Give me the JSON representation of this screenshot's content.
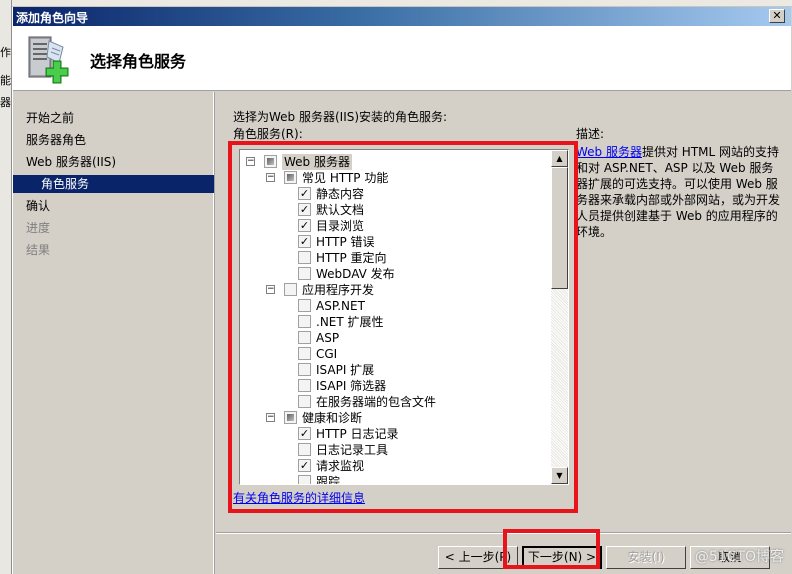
{
  "window": {
    "title": "添加角色向导",
    "close_icon": "close-icon"
  },
  "header": {
    "heading": "选择角色服务",
    "icon": "server-add-icon"
  },
  "background_app": {
    "fragments": [
      "作",
      "能",
      "器"
    ]
  },
  "nav": {
    "items": [
      {
        "label": "开始之前",
        "state": "normal"
      },
      {
        "label": "服务器角色",
        "state": "normal"
      },
      {
        "label": "Web 服务器(IIS)",
        "state": "normal"
      },
      {
        "label": "角色服务",
        "state": "active"
      },
      {
        "label": "确认",
        "state": "normal"
      },
      {
        "label": "进度",
        "state": "disabled"
      },
      {
        "label": "结果",
        "state": "disabled"
      }
    ]
  },
  "main": {
    "intro": "选择为Web 服务器(IIS)安装的角色服务:",
    "list_label": "角色服务(R):",
    "description_label": "描述:",
    "description_link": "Web 服务器",
    "description_text": "提供对 HTML 网站的支持和对 ASP.NET、ASP 以及 Web 服务器扩展的可选支持。可以使用 Web 服务器来承载内部或外部网站，或为开发人员提供创建基于 Web 的应用程序的环境。",
    "more_info_link": "有关角色服务的详细信息",
    "tree": [
      {
        "label": "Web 服务器",
        "level": 0,
        "expander": "⊟",
        "state": "partial",
        "selected": true
      },
      {
        "label": "常见 HTTP 功能",
        "level": 1,
        "expander": "⊟",
        "state": "partial"
      },
      {
        "label": "静态内容",
        "level": 2,
        "state": "checked"
      },
      {
        "label": "默认文档",
        "level": 2,
        "state": "checked"
      },
      {
        "label": "目录浏览",
        "level": 2,
        "state": "checked"
      },
      {
        "label": "HTTP 错误",
        "level": 2,
        "state": "checked"
      },
      {
        "label": "HTTP 重定向",
        "level": 2,
        "state": "unchecked"
      },
      {
        "label": "WebDAV 发布",
        "level": 2,
        "state": "unchecked"
      },
      {
        "label": "应用程序开发",
        "level": 1,
        "expander": "⊟",
        "state": "unchecked"
      },
      {
        "label": "ASP.NET",
        "level": 2,
        "state": "unchecked"
      },
      {
        "label": ".NET 扩展性",
        "level": 2,
        "state": "unchecked"
      },
      {
        "label": "ASP",
        "level": 2,
        "state": "unchecked"
      },
      {
        "label": "CGI",
        "level": 2,
        "state": "unchecked"
      },
      {
        "label": "ISAPI 扩展",
        "level": 2,
        "state": "unchecked"
      },
      {
        "label": "ISAPI 筛选器",
        "level": 2,
        "state": "unchecked"
      },
      {
        "label": "在服务器端的包含文件",
        "level": 2,
        "state": "unchecked"
      },
      {
        "label": "健康和诊断",
        "level": 1,
        "expander": "⊟",
        "state": "partial"
      },
      {
        "label": "HTTP 日志记录",
        "level": 2,
        "state": "checked"
      },
      {
        "label": "日志记录工具",
        "level": 2,
        "state": "unchecked"
      },
      {
        "label": "请求监视",
        "level": 2,
        "state": "checked"
      },
      {
        "label": "跟踪",
        "level": 2,
        "state": "unchecked"
      }
    ],
    "scroll": {
      "up": "▲",
      "down": "▼"
    }
  },
  "footer": {
    "prev_label": "< 上一步(P)",
    "next_label": "下一步(N) >",
    "install_label": "安装(I)",
    "cancel_label": "取消"
  },
  "watermark": "@51CTO博客",
  "colors": {
    "highlight": "#e8141c",
    "nav_active": "#0a246a",
    "link": "#0000ee"
  }
}
